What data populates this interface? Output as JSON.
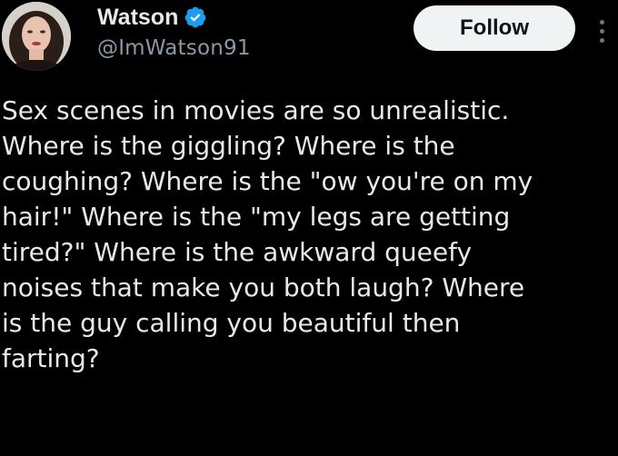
{
  "author": {
    "display_name": "Watson",
    "handle": "@ImWatson91",
    "verified": true,
    "avatar_icon": "avatar-photo",
    "verified_icon": "verified-badge-icon",
    "verified_color": "#1d9bf0"
  },
  "actions": {
    "follow_label": "Follow",
    "more_icon": "more-options-icon"
  },
  "tweet": {
    "lines": [
      "Sex scenes in movies are so unrealistic.",
      "Where is the giggling? Where is the",
      "coughing? Where is the \"ow you're on my",
      "hair!\" Where is the \"my legs are getting",
      "tired?\" Where is the awkward queefy",
      "noises that make you both laugh? Where",
      "is the guy calling you beautiful then",
      "farting?"
    ]
  },
  "colors": {
    "background": "#000000",
    "text_primary": "#e7e9ea",
    "text_secondary": "#8b98a5",
    "follow_bg": "#eff3f4",
    "follow_text": "#0f1419"
  }
}
